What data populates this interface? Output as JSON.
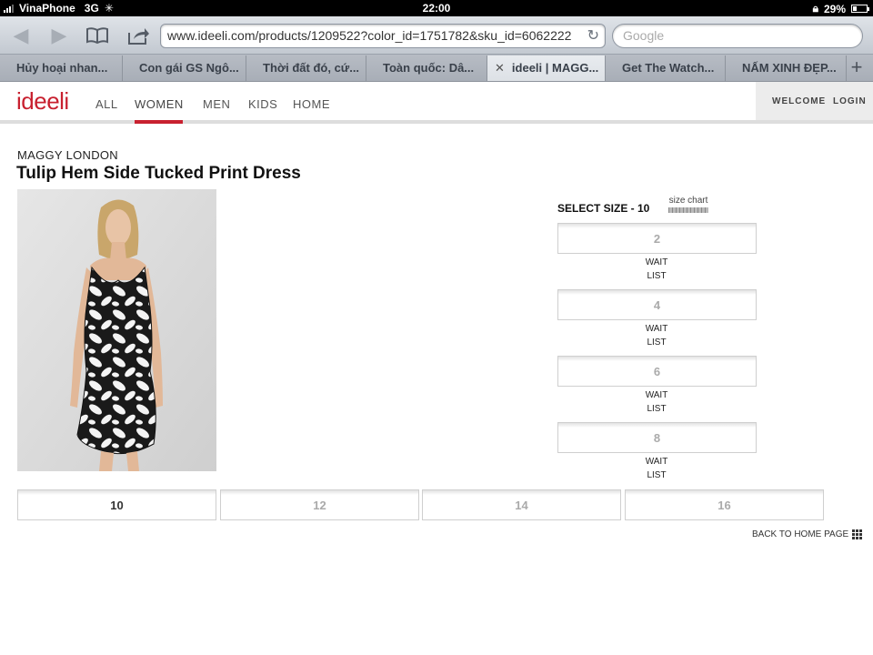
{
  "status": {
    "carrier": "VinaPhone",
    "network": "3G",
    "time": "22:00",
    "battery": "29%",
    "battery_level": 0.29
  },
  "browser": {
    "url": "www.ideeli.com/products/1209522?color_id=1751782&sku_id=6062222",
    "search_placeholder": "Google",
    "tabs": [
      "Hủy hoại nhan...",
      "Con gái GS Ngô...",
      "Thời đất đó, cứ...",
      "Toàn quốc: Dâ...",
      "ideeli | MAGG...",
      "Get The Watch...",
      "NẤM XINH ĐẸP..."
    ],
    "active_tab_index": 4
  },
  "site": {
    "logo": "ideeli",
    "nav": [
      "ALL",
      "WOMEN",
      "MEN",
      "KIDS",
      "HOME"
    ],
    "active_nav": "WOMEN",
    "welcome": "WELCOME",
    "login": "LOGIN"
  },
  "product": {
    "brand": "MAGGY LONDON",
    "title": "Tulip Hem Side Tucked Print Dress",
    "select_size_label": "SELECT SIZE - 10",
    "size_chart_label": "size chart",
    "waitlist_sizes": [
      "2",
      "4",
      "6",
      "8"
    ],
    "wait_line1": "WAIT",
    "wait_line2": "LIST",
    "bottom_sizes": [
      "10",
      "12",
      "14",
      "16"
    ],
    "selected_size": "10"
  },
  "footer": {
    "back_home": "BACK TO HOME PAGE"
  },
  "colors": {
    "brand_red": "#c8202f"
  }
}
